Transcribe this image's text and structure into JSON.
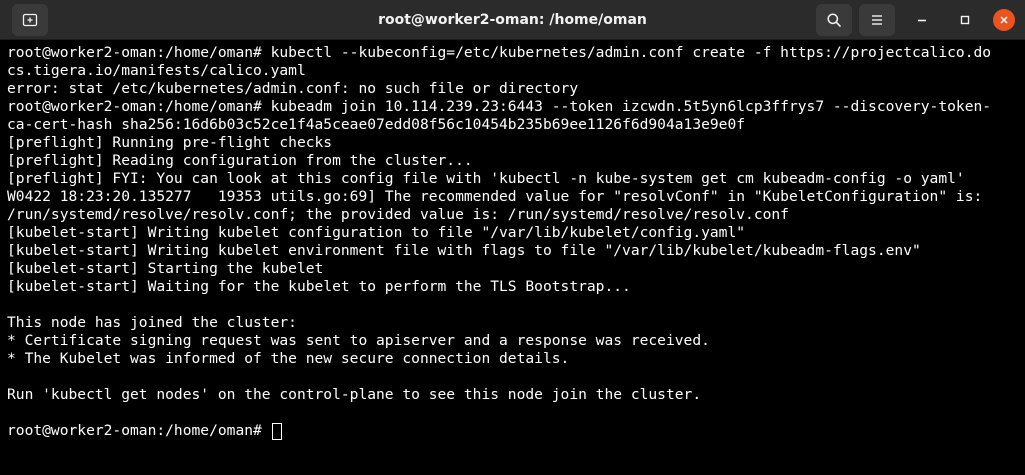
{
  "window": {
    "title": "root@worker2-oman: /home/oman"
  },
  "icons": {
    "new_tab": "new-tab-icon",
    "search": "search-icon",
    "menu": "hamburger-menu-icon",
    "minimize": "minimize-icon",
    "maximize": "maximize-icon",
    "close": "close-icon"
  },
  "colors": {
    "titlebar_bg": "#2b2b2b",
    "terminal_bg": "#000000",
    "terminal_fg": "#ffffff",
    "close_button": "#e95420"
  },
  "terminal": {
    "lines": [
      "root@worker2-oman:/home/oman# kubectl --kubeconfig=/etc/kubernetes/admin.conf create -f https://projectcalico.do",
      "cs.tigera.io/manifests/calico.yaml",
      "error: stat /etc/kubernetes/admin.conf: no such file or directory",
      "root@worker2-oman:/home/oman# kubeadm join 10.114.239.23:6443 --token izcwdn.5t5yn6lcp3ffrys7 --discovery-token-",
      "ca-cert-hash sha256:16d6b03c52ce1f4a5ceae07edd08f56c10454b235b69ee1126f6d904a13e9e0f",
      "[preflight] Running pre-flight checks",
      "[preflight] Reading configuration from the cluster...",
      "[preflight] FYI: You can look at this config file with 'kubectl -n kube-system get cm kubeadm-config -o yaml'",
      "W0422 18:23:20.135277   19353 utils.go:69] The recommended value for \"resolvConf\" in \"KubeletConfiguration\" is:",
      "/run/systemd/resolve/resolv.conf; the provided value is: /run/systemd/resolve/resolv.conf",
      "[kubelet-start] Writing kubelet configuration to file \"/var/lib/kubelet/config.yaml\"",
      "[kubelet-start] Writing kubelet environment file with flags to file \"/var/lib/kubelet/kubeadm-flags.env\"",
      "[kubelet-start] Starting the kubelet",
      "[kubelet-start] Waiting for the kubelet to perform the TLS Bootstrap...",
      "",
      "This node has joined the cluster:",
      "* Certificate signing request was sent to apiserver and a response was received.",
      "* The Kubelet was informed of the new secure connection details.",
      "",
      "Run 'kubectl get nodes' on the control-plane to see this node join the cluster.",
      ""
    ],
    "prompt": "root@worker2-oman:/home/oman# "
  }
}
